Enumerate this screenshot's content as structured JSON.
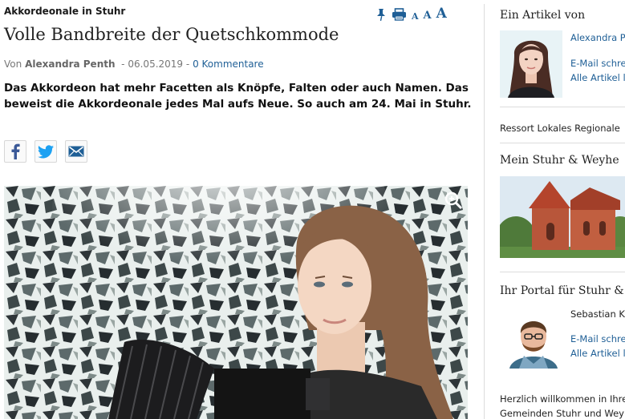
{
  "article": {
    "topic": "Akkordeonale in Stuhr",
    "title": "Volle Bandbreite der Quetschkommode",
    "byline": {
      "prefix": "Von",
      "author": "Alexandra Penth",
      "separator1": "-",
      "date": "06.05.2019",
      "separator2": "-",
      "comments": "0 Kommentare"
    },
    "lead": "Das Akkordeon hat mehr Facetten als Knöpfe, Falten oder auch Namen. Das beweist die Akkordeonale jedes Mal aufs Neue. So auch am 24. Mai in Stuhr."
  },
  "tools": {
    "font_small": "A",
    "font_medium": "A",
    "font_large": "A"
  },
  "colors": {
    "link": "#1f5f96",
    "facebook": "#3b5998",
    "twitter": "#1da1f2",
    "mail": "#1f5f96"
  },
  "sidebar": {
    "author_box": {
      "heading": "Ein Artikel von",
      "name": "Alexandra P",
      "email_link": "E-Mail schre",
      "all_articles_link": "Alle Artikel le"
    },
    "ressort": "Ressort Lokales Regionale",
    "region_box": {
      "heading": "Mein Stuhr & Weyhe"
    },
    "portal_box": {
      "heading": "Ihr Portal für Stuhr & W",
      "name": "Sebastian K",
      "email_link": "E-Mail schre",
      "all_articles_link": "Alle Artikel le"
    },
    "welcome_line1": "Herzlich willkommen in Ihre",
    "welcome_line2": "Gemeinden Stuhr und Weyh"
  }
}
